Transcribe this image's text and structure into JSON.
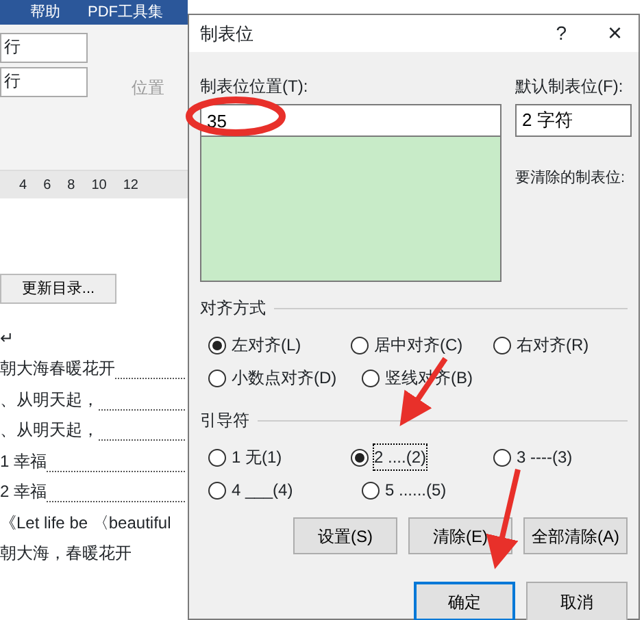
{
  "ribbon": {
    "tabs": [
      "帮助",
      "PDF工具集"
    ],
    "spin_fields": [
      {
        "value": "行"
      },
      {
        "value": "行"
      }
    ],
    "position_button": {
      "label": "位置",
      "disabled": true
    }
  },
  "ruler": {
    "ticks": [
      "4",
      "6",
      "8",
      "10",
      "12"
    ]
  },
  "update_toc_button": {
    "label": "更新目录..."
  },
  "document": {
    "lines": [
      {
        "text": "↵",
        "leader": false
      },
      {
        "text": "朝大海春暖花开",
        "leader": true
      },
      {
        "text": "、从明天起，",
        "leader": true
      },
      {
        "text": "、从明天起，",
        "leader": true
      },
      {
        "text": "1  幸福",
        "leader": true
      },
      {
        "text": "2  幸福",
        "leader": true
      },
      {
        "text": "《Let life be 〈beautiful",
        "leader": false
      },
      {
        "text": "朝大海，春暖花开",
        "leader": false
      }
    ]
  },
  "dialog": {
    "title": "制表位",
    "help": "?",
    "close": "×",
    "tab_position": {
      "label": "制表位位置(T):",
      "value": "35"
    },
    "default_tab": {
      "label": "默认制表位(F):",
      "value": "2 字符"
    },
    "to_clear": {
      "label": "要清除的制表位:"
    },
    "alignment": {
      "title": "对齐方式",
      "options": [
        {
          "label": "左对齐(L)",
          "selected": true
        },
        {
          "label": "居中对齐(C)",
          "selected": false
        },
        {
          "label": "右对齐(R)",
          "selected": false
        },
        {
          "label": "小数点对齐(D)",
          "selected": false
        },
        {
          "label": "竖线对齐(B)",
          "selected": false
        }
      ]
    },
    "leader": {
      "title": "引导符",
      "options": [
        {
          "label": "1 无(1)",
          "selected": false
        },
        {
          "label": "2 ....(2)",
          "selected": true
        },
        {
          "label": "3 ----(3)",
          "selected": false
        },
        {
          "label": "4 ___(4)",
          "selected": false
        },
        {
          "label": "5 ......(5)",
          "selected": false
        }
      ]
    },
    "buttons": [
      {
        "label": "设置(S)",
        "default": false
      },
      {
        "label": "清除(E)",
        "default": false
      },
      {
        "label": "全部清除(A)",
        "default": false
      }
    ],
    "footer_buttons": [
      {
        "label": "确定",
        "default": true
      },
      {
        "label": "取消",
        "default": false
      }
    ]
  }
}
